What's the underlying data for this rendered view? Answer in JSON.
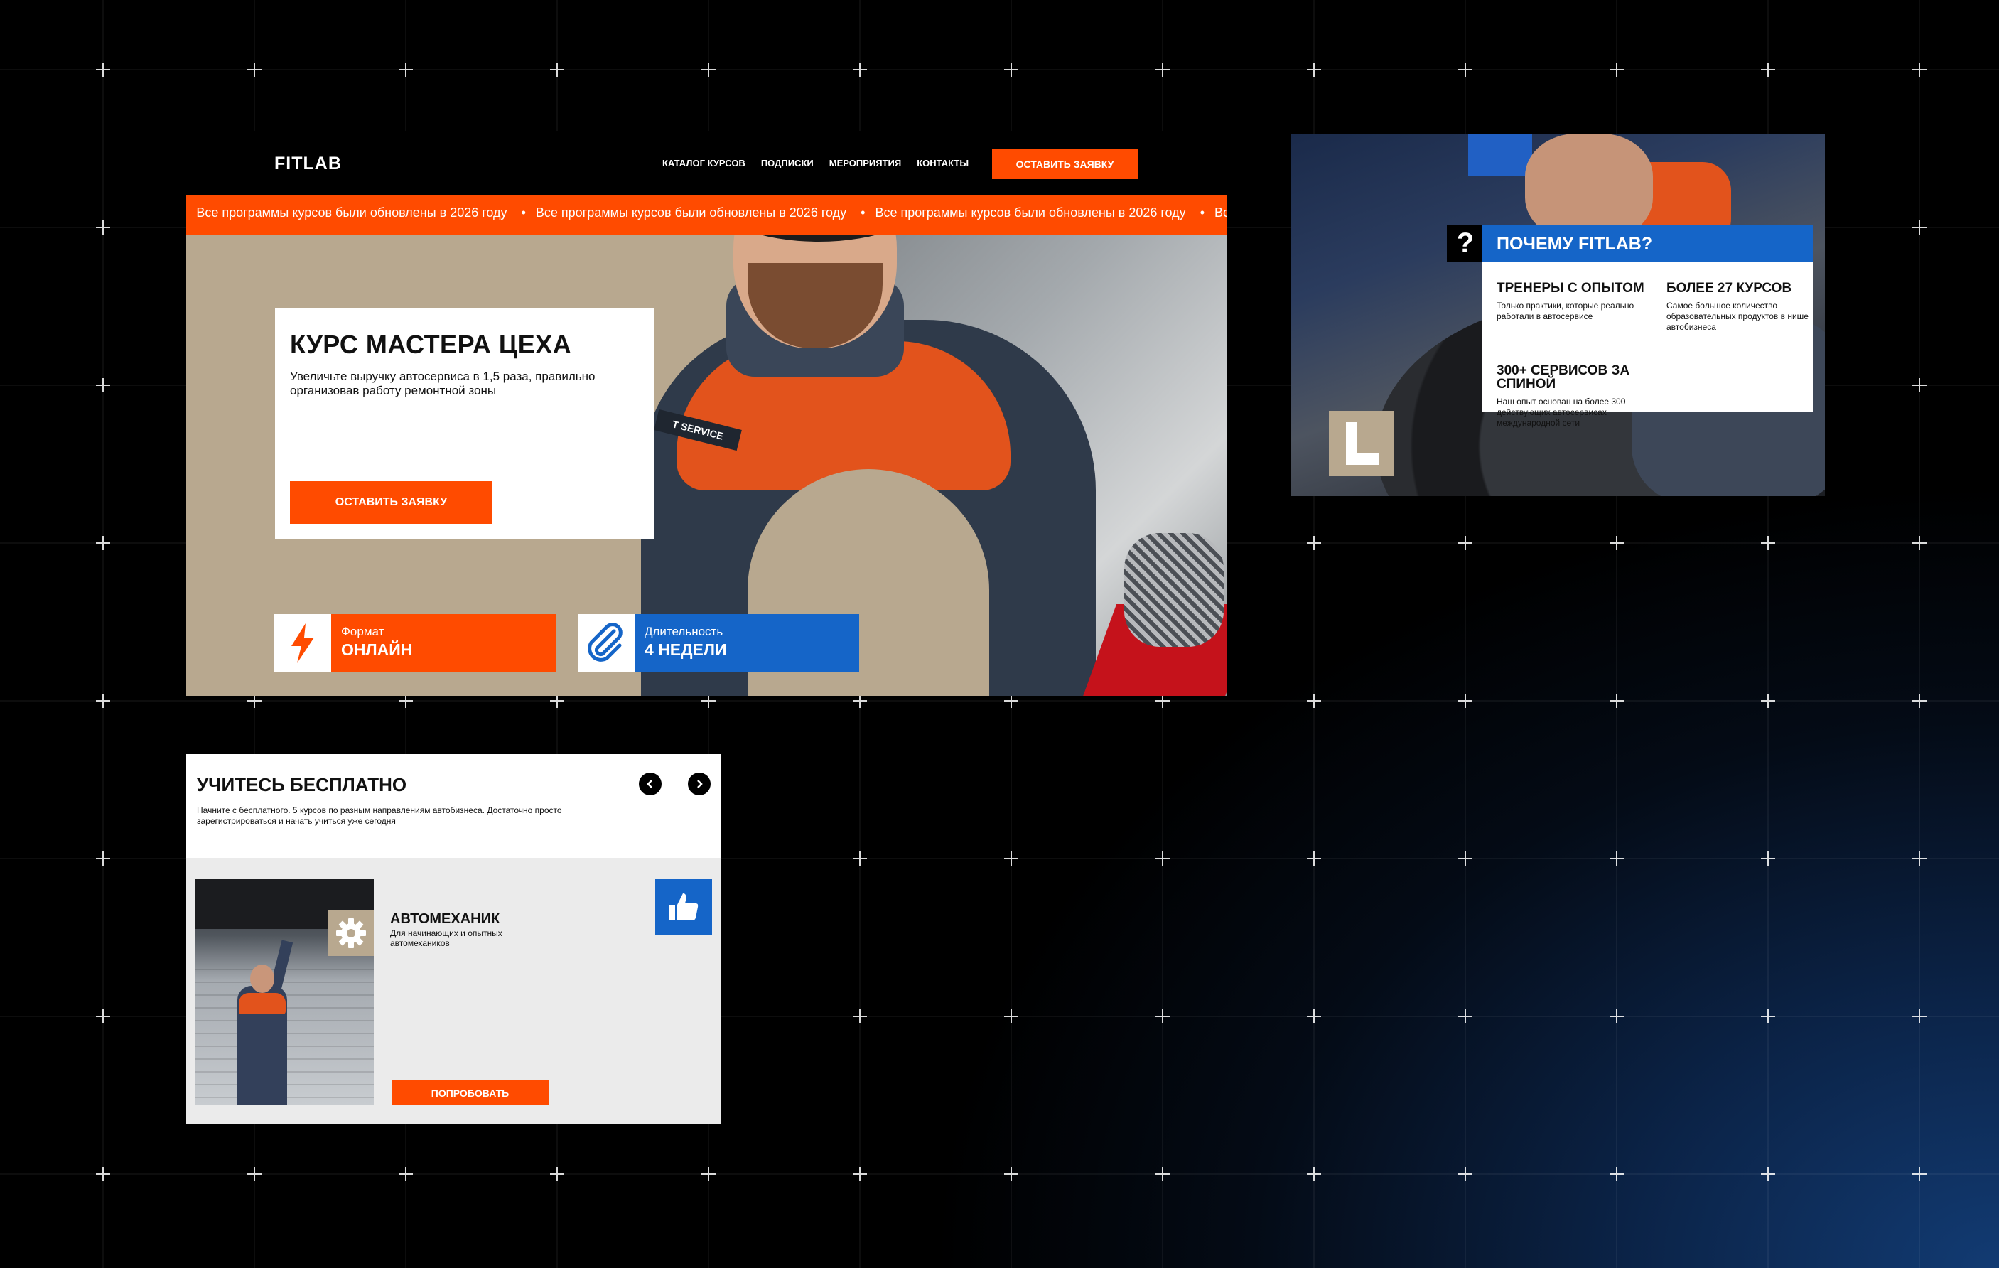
{
  "colors": {
    "accent": "#ff4b00",
    "blue": "#1565c8",
    "beige": "#b8a88f",
    "black": "#000000",
    "white": "#ffffff"
  },
  "hero": {
    "logo": "FITLAB",
    "nav": [
      "КАТАЛОГ КУРСОВ",
      "ПОДПИСКИ",
      "МЕРОПРИЯТИЯ",
      "КОНТАКТЫ"
    ],
    "nav_cta": "ОСТАВИТЬ ЗАЯВКУ",
    "ticker_text": "Все программы курсов были обновлены в 2026 году",
    "title": "КУРС МАСТЕРА ЦЕХА",
    "subtitle": "Увеличьте выручку автосервиса в 1,5 раза, правильно организовав работу ремонтной зоны",
    "cta": "ОСТАВИТЬ ЗАЯВКУ",
    "photo_label": "T SERVICE",
    "format": {
      "label": "Формат",
      "value": "ОНЛАЙН",
      "icon": "lightning-icon"
    },
    "duration": {
      "label": "Длительность",
      "value": "4 НЕДЕЛИ",
      "icon": "paperclip-icon"
    }
  },
  "why": {
    "question_mark": "?",
    "letter": "L",
    "title": "ПОЧЕМУ FITLAB?",
    "features": [
      {
        "title": "ТРЕНЕРЫ С ОПЫТОМ",
        "text": "Только практики, которые реально работали в автосервисе"
      },
      {
        "title": "БОЛЕЕ 27 КУРСОВ",
        "text": "Самое большое количество образовательных продуктов в нише автобизнеса"
      },
      {
        "title": "300+ СЕРВИСОВ ЗА СПИНОЙ",
        "text": "Наш опыт основан на более 300 действующих автосервисах международной сети"
      }
    ]
  },
  "free": {
    "title": "УЧИТЕСЬ БЕСПЛАТНО",
    "subtitle": "Начните с бесплатного. 5 курсов по разным направлениям автобизнеса. Достаточно просто зарегистрироваться и начать учиться уже сегодня",
    "course": {
      "title": "АВТОМЕХАНИК",
      "subtitle": "Для начинающих и опытных автомехаников",
      "cta": "ПОПРОБОВАТЬ",
      "badge_icon": "gear-icon",
      "action_icon": "thumbs-up-icon"
    }
  }
}
